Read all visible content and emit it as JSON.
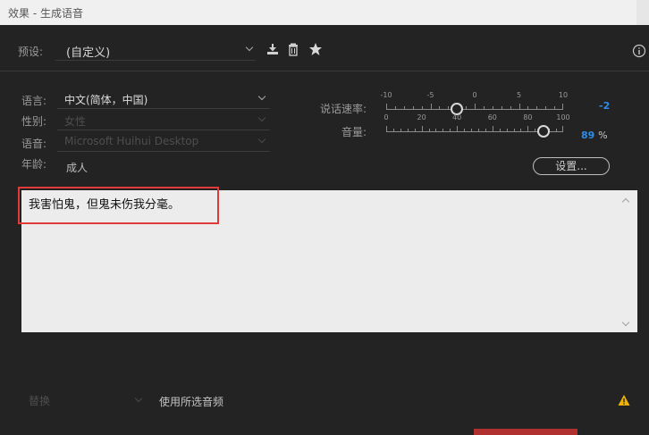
{
  "window": {
    "title": "效果 - 生成语音"
  },
  "preset": {
    "label": "预设:",
    "value": "(自定义)"
  },
  "fields": {
    "language": {
      "label": "语言:",
      "value": "中文(简体，中国)",
      "disabled": false
    },
    "gender": {
      "label": "性别:",
      "value": "女性",
      "disabled": true
    },
    "voice": {
      "label": "语音:",
      "value": "Microsoft Huihui Desktop",
      "disabled": true
    },
    "age": {
      "label": "年龄:",
      "value": "成人"
    }
  },
  "speech_rate": {
    "label": "说话速率:",
    "ticks": [
      "-10",
      "-5",
      "0",
      "5",
      "10"
    ],
    "min": -10,
    "max": 10,
    "value": -2,
    "value_text": "-2"
  },
  "volume": {
    "label": "音量:",
    "ticks": [
      "0",
      "20",
      "40",
      "60",
      "80",
      "100"
    ],
    "min": 0,
    "max": 100,
    "value": 89,
    "value_text": "89",
    "unit": "%"
  },
  "settings_button": {
    "label": "设置..."
  },
  "text_input": {
    "content": "我害怕鬼，但鬼未伤我分毫。"
  },
  "bottom": {
    "replace_select": {
      "value": "替换"
    },
    "use_selected_audio": {
      "label": "使用所选音频"
    }
  },
  "colors": {
    "accent": "#2d8ceb",
    "highlight": "#e03a3a",
    "warning": "#f0b400",
    "background": "#232323"
  }
}
